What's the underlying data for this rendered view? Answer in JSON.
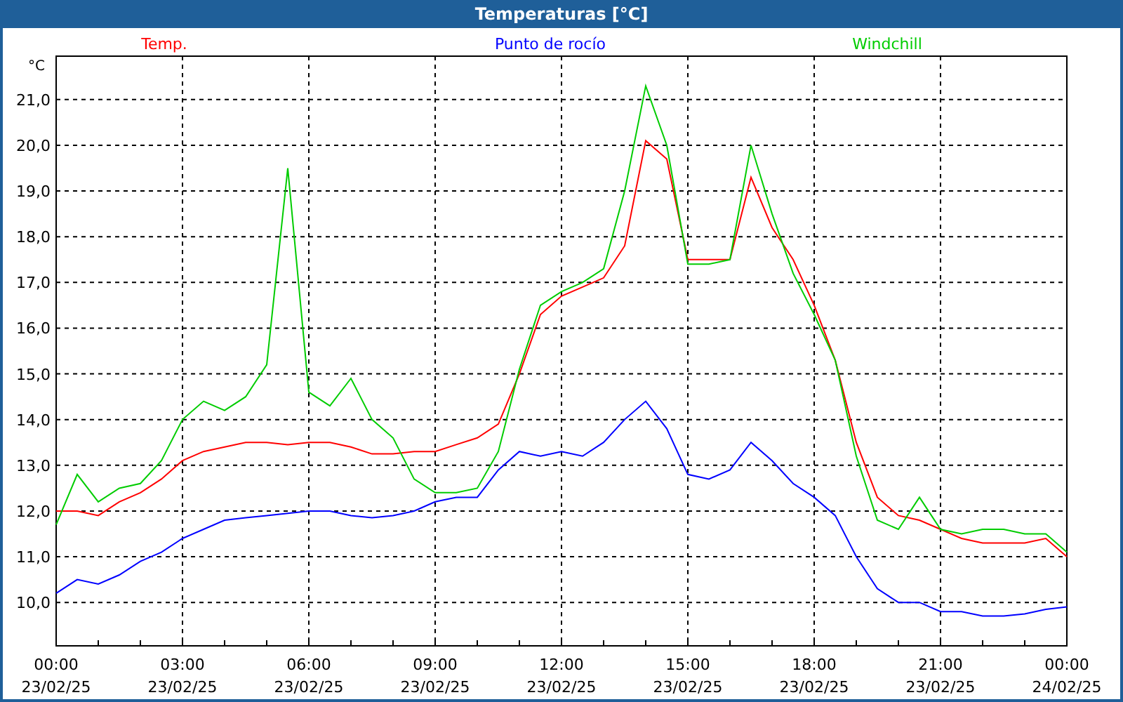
{
  "window": {
    "title": "Temperaturas [°C]"
  },
  "chart": {
    "x_dates": [
      "23/02/25",
      "23/02/25",
      "23/02/25",
      "23/02/25",
      "23/02/25",
      "23/02/25",
      "23/02/25",
      "23/02/25",
      "24/02/25"
    ],
    "chart_data": {
      "type": "line",
      "ylabel": "°C",
      "grid": true,
      "xlim": [
        0,
        24
      ],
      "ylim": [
        9.05,
        21.95
      ],
      "yticks": [
        {
          "value": 10,
          "label": "10,0"
        },
        {
          "value": 11,
          "label": "11,0"
        },
        {
          "value": 12,
          "label": "12,0"
        },
        {
          "value": 13,
          "label": "13,0"
        },
        {
          "value": 14,
          "label": "14,0"
        },
        {
          "value": 15,
          "label": "15,0"
        },
        {
          "value": 16,
          "label": "16,0"
        },
        {
          "value": 17,
          "label": "17,0"
        },
        {
          "value": 18,
          "label": "18,0"
        },
        {
          "value": 19,
          "label": "19,0"
        },
        {
          "value": 20,
          "label": "20,0"
        },
        {
          "value": 21,
          "label": "21,0"
        }
      ],
      "xticks": [
        {
          "value": 0,
          "label": "00:00"
        },
        {
          "value": 3,
          "label": "03:00"
        },
        {
          "value": 6,
          "label": "06:00"
        },
        {
          "value": 9,
          "label": "09:00"
        },
        {
          "value": 12,
          "label": "12:00"
        },
        {
          "value": 15,
          "label": "15:00"
        },
        {
          "value": 18,
          "label": "18:00"
        },
        {
          "value": 21,
          "label": "21:00"
        },
        {
          "value": 24,
          "label": "00:00"
        }
      ],
      "x": [
        0,
        0.5,
        1,
        1.5,
        2,
        2.5,
        3,
        3.5,
        4,
        4.5,
        5,
        5.5,
        6,
        6.5,
        7,
        7.5,
        8,
        8.5,
        9,
        9.5,
        10,
        10.5,
        11,
        11.5,
        12,
        12.5,
        13,
        13.5,
        14,
        14.5,
        15,
        15.5,
        16,
        16.5,
        17,
        17.5,
        18,
        18.5,
        19,
        19.5,
        20,
        20.5,
        21,
        21.5,
        22,
        22.5,
        23,
        23.5,
        24
      ],
      "series": [
        {
          "name": "Temp.",
          "color": "#ff0000",
          "values": [
            12.0,
            12.0,
            11.9,
            12.2,
            12.4,
            12.7,
            13.1,
            13.3,
            13.4,
            13.5,
            13.5,
            13.45,
            13.5,
            13.5,
            13.4,
            13.25,
            13.25,
            13.3,
            13.3,
            13.45,
            13.6,
            13.9,
            15.0,
            16.3,
            16.7,
            16.9,
            17.1,
            17.8,
            20.1,
            19.7,
            17.5,
            17.5,
            17.5,
            19.3,
            18.2,
            17.5,
            16.5,
            15.3,
            13.5,
            12.3,
            11.9,
            11.8,
            11.6,
            11.4,
            11.3,
            11.3,
            11.3,
            11.4,
            11.0
          ]
        },
        {
          "name": "Punto de rocío",
          "color": "#0000ff",
          "values": [
            10.2,
            10.5,
            10.4,
            10.6,
            10.9,
            11.1,
            11.4,
            11.6,
            11.8,
            11.85,
            11.9,
            11.95,
            12.0,
            12.0,
            11.9,
            11.85,
            11.9,
            12.0,
            12.2,
            12.3,
            12.3,
            12.9,
            13.3,
            13.2,
            13.3,
            13.2,
            13.5,
            14.0,
            14.4,
            13.8,
            12.8,
            12.7,
            12.9,
            13.5,
            13.1,
            12.6,
            12.3,
            11.9,
            11.0,
            10.3,
            10.0,
            10.0,
            9.8,
            9.8,
            9.7,
            9.7,
            9.75,
            9.85,
            9.9
          ]
        },
        {
          "name": "Windchill",
          "color": "#00cc00",
          "values": [
            11.7,
            12.8,
            12.2,
            12.5,
            12.6,
            13.1,
            14.0,
            14.4,
            14.2,
            14.5,
            15.2,
            19.5,
            14.6,
            14.3,
            14.9,
            14.0,
            13.6,
            12.7,
            12.4,
            12.4,
            12.5,
            13.3,
            15.1,
            16.5,
            16.8,
            17.0,
            17.3,
            19.0,
            21.3,
            20.0,
            17.4,
            17.4,
            17.5,
            20.0,
            18.5,
            17.2,
            16.3,
            15.3,
            13.2,
            11.8,
            11.6,
            12.3,
            11.6,
            11.5,
            11.6,
            11.6,
            11.5,
            11.5,
            11.1
          ]
        }
      ]
    }
  }
}
